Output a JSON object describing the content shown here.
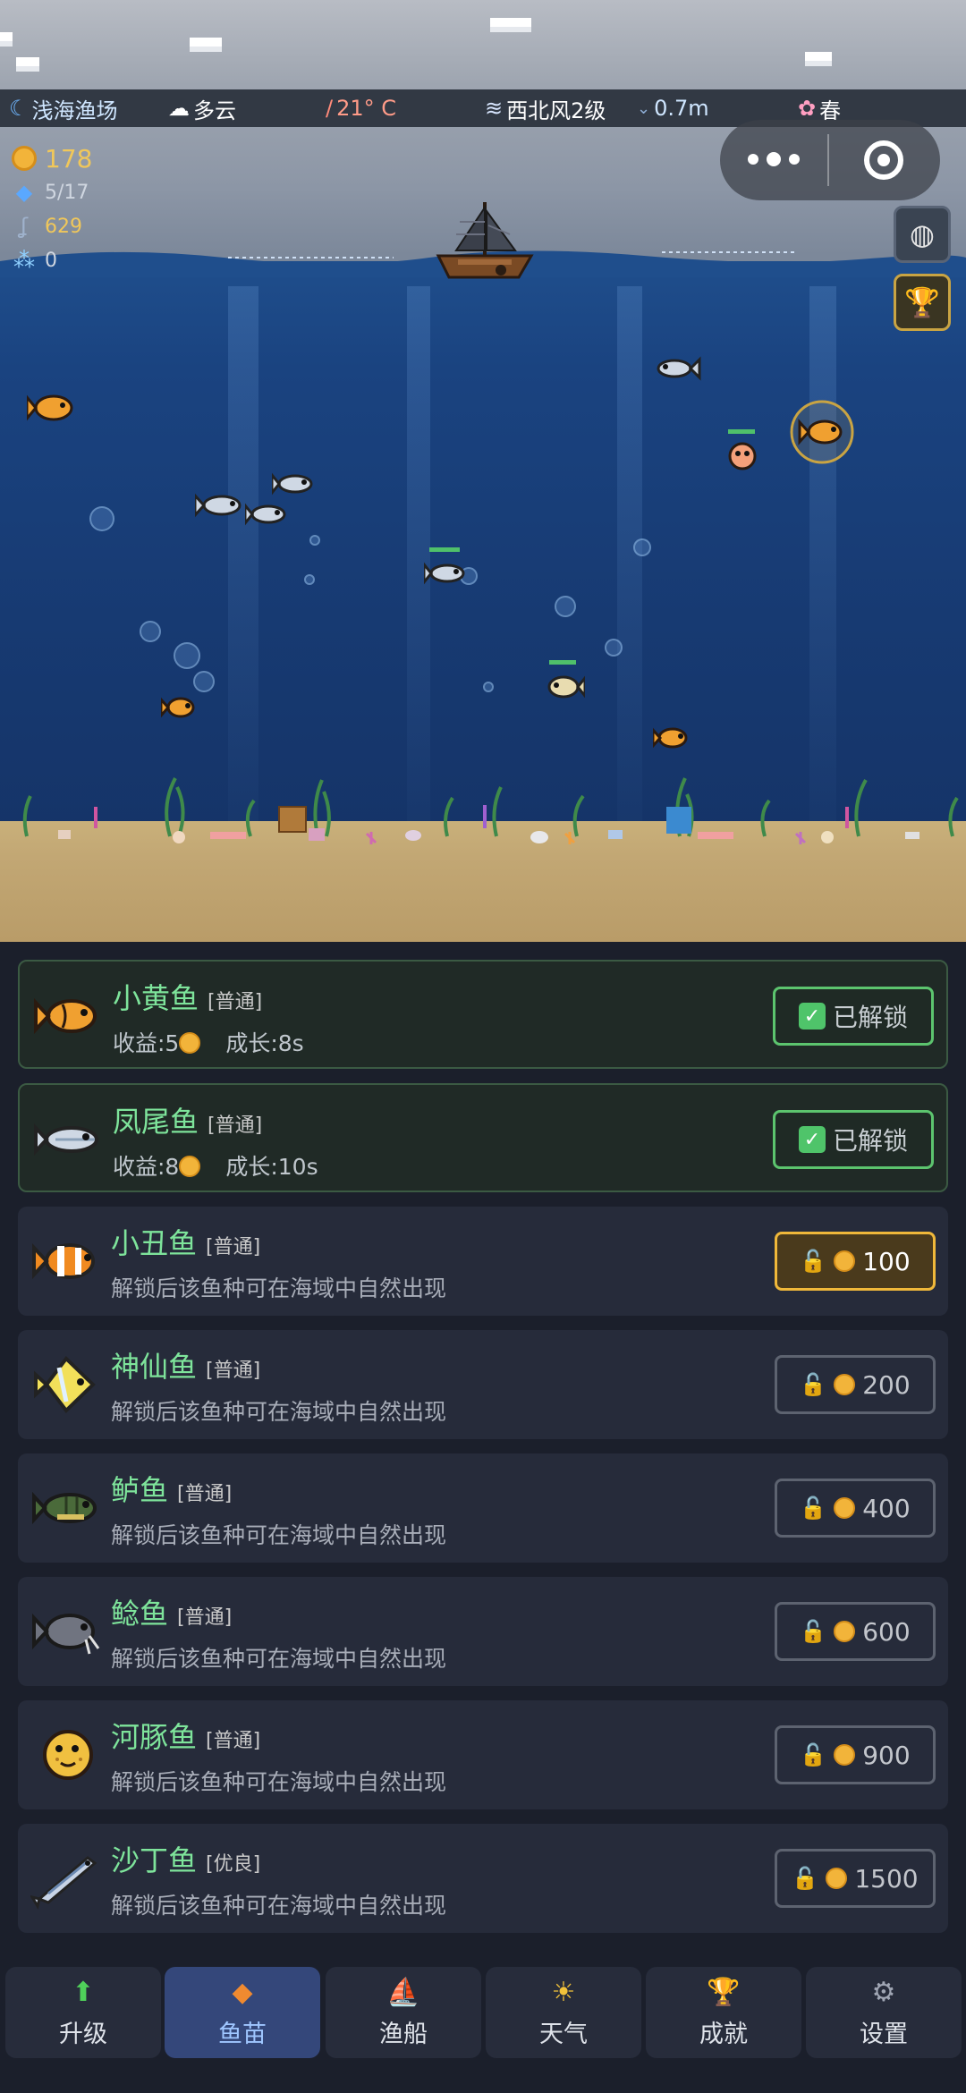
{
  "status": {
    "location": "浅海渔场",
    "weather": "多云",
    "temperature": "21° C",
    "wind": "西北风2级",
    "wave": "0.7m",
    "season": "春"
  },
  "resources": {
    "coins": "178",
    "fish_count": "5/17",
    "hook": "629",
    "bubbles": "0"
  },
  "side_buttons": [
    "shell-icon",
    "trophy-icon"
  ],
  "fish_list": [
    {
      "name": "小黄鱼",
      "rarity": "[普通]",
      "income_label": "收益:5",
      "growth_label": "成长:8s",
      "state": "已解锁",
      "unlocked": true
    },
    {
      "name": "凤尾鱼",
      "rarity": "[普通]",
      "income_label": "收益:8",
      "growth_label": "成长:10s",
      "state": "已解锁",
      "unlocked": true
    },
    {
      "name": "小丑鱼",
      "rarity": "[普通]",
      "desc": "解锁后该鱼种可在海域中自然出现",
      "price": "100",
      "affordable": true
    },
    {
      "name": "神仙鱼",
      "rarity": "[普通]",
      "desc": "解锁后该鱼种可在海域中自然出现",
      "price": "200"
    },
    {
      "name": "鲈鱼",
      "rarity": "[普通]",
      "desc": "解锁后该鱼种可在海域中自然出现",
      "price": "400"
    },
    {
      "name": "鲶鱼",
      "rarity": "[普通]",
      "desc": "解锁后该鱼种可在海域中自然出现",
      "price": "600"
    },
    {
      "name": "河豚鱼",
      "rarity": "[普通]",
      "desc": "解锁后该鱼种可在海域中自然出现",
      "price": "900"
    },
    {
      "name": "沙丁鱼",
      "rarity": "[优良]",
      "desc": "解锁后该鱼种可在海域中自然出现",
      "price": "1500"
    }
  ],
  "tabs": [
    {
      "label": "升级",
      "icon": "up-arrow-icon"
    },
    {
      "label": "鱼苗",
      "icon": "fish-icon",
      "active": true
    },
    {
      "label": "渔船",
      "icon": "boat-icon"
    },
    {
      "label": "天气",
      "icon": "sun-icon"
    },
    {
      "label": "成就",
      "icon": "trophy-icon"
    },
    {
      "label": "设置",
      "icon": "gear-icon"
    }
  ],
  "colors": {
    "accent_green": "#7ee49b",
    "coin_gold": "#f2b43a",
    "active_tab": "#34477a",
    "water": "#1a4380",
    "sand": "#c2a774"
  }
}
